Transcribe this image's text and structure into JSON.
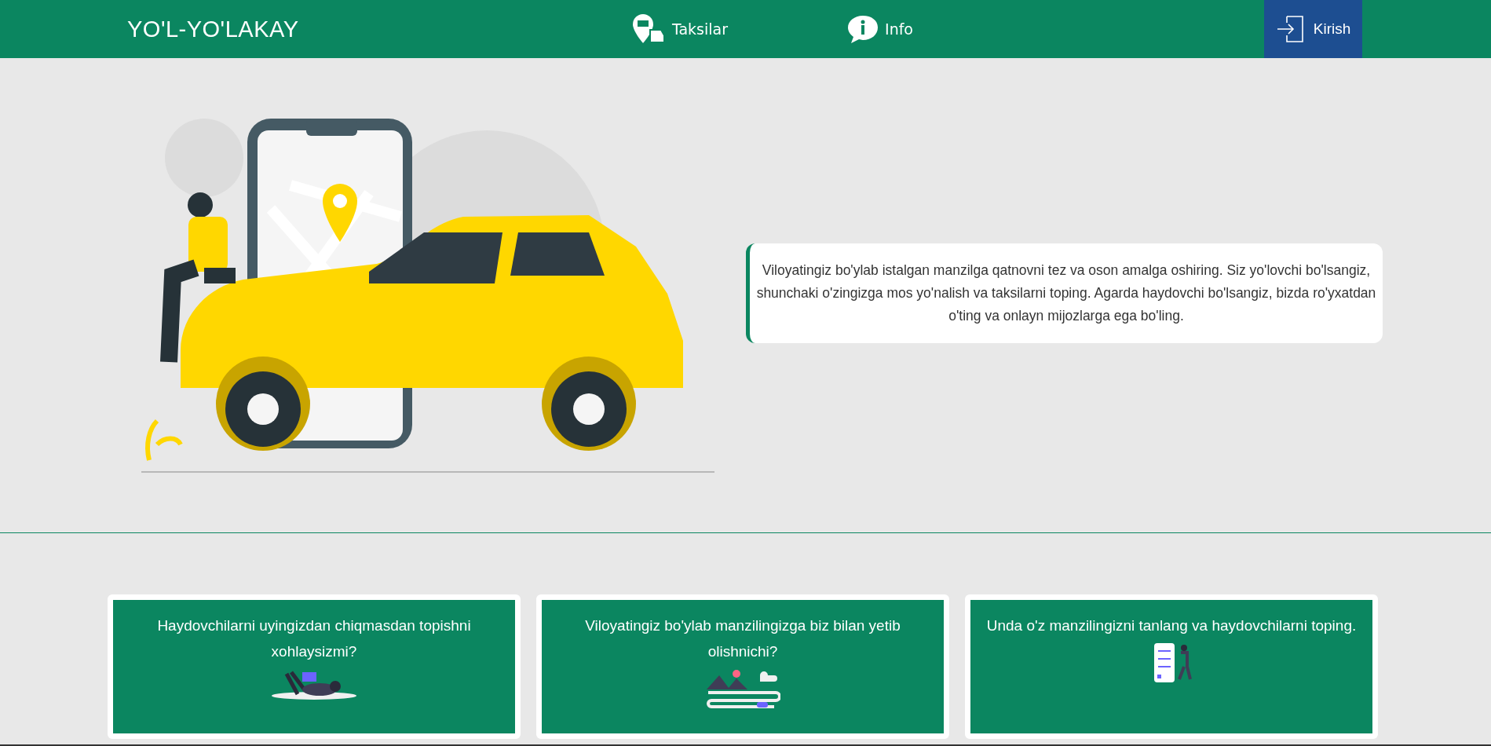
{
  "header": {
    "logo": "YO'L-YO'LAKAY",
    "nav": [
      {
        "kind": "taxi",
        "label": "Taksilar"
      },
      {
        "kind": "info",
        "label": "Info"
      }
    ],
    "login_button": "Kirish"
  },
  "hero": {
    "text": "Viloyatingiz bo'ylab istalgan manzilga qatnovni tez va oson amalga oshiring. Siz yo'lovchi bo'lsangiz, shunchaki o'zingizga mos yo'nalish va taksilarni toping. Agarda haydovchi bo'lsangiz, bizda ro'yxatdan o'ting va onlayn mijozlarga ega bo'ling."
  },
  "cards": [
    {
      "kind": "relax",
      "text": "Haydovchilarni uyingizdan chiqmasdan topishni xohlaysizmi?"
    },
    {
      "kind": "road",
      "text": "Viloyatingiz bo'ylab manzilingizga biz bilan yetib olishnichi?"
    },
    {
      "kind": "phone",
      "text": "Unda o'z manzilingizni tanlang va haydovchilarni toping."
    }
  ]
}
